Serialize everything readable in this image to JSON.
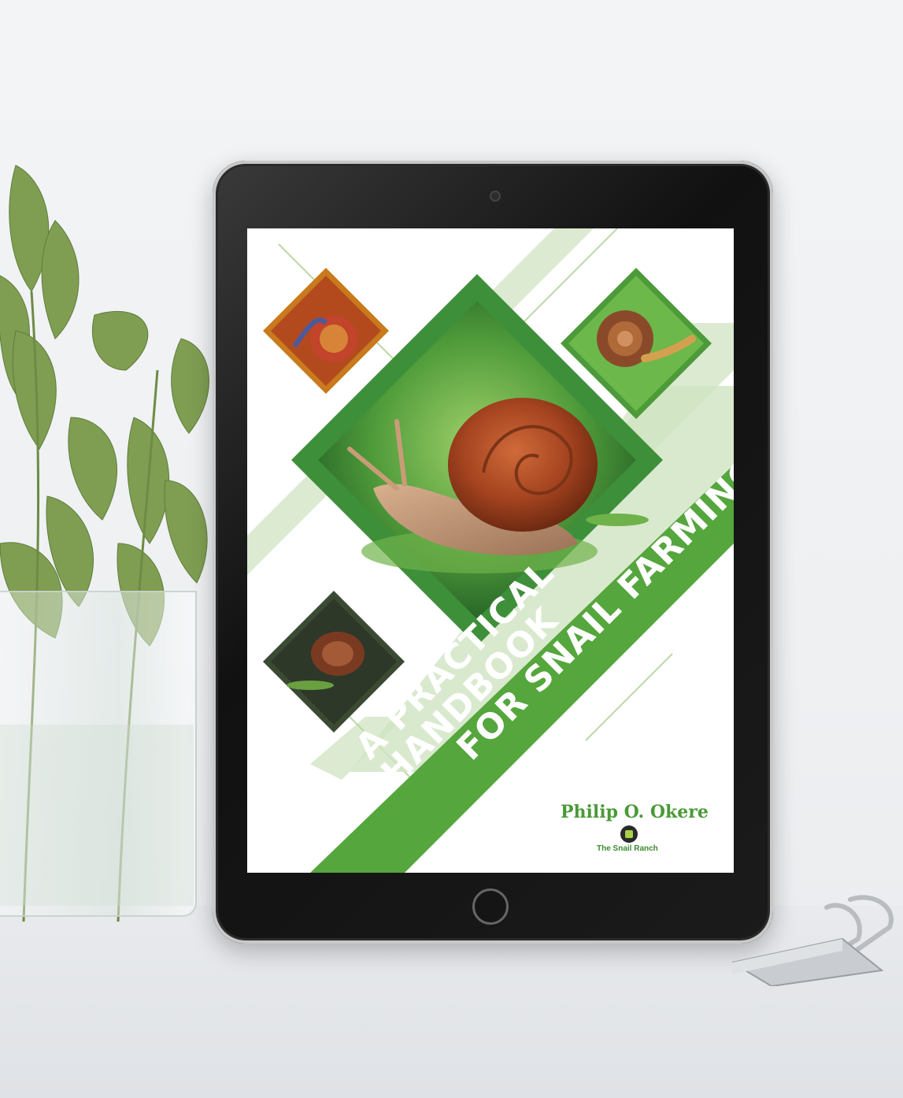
{
  "cover": {
    "title_line1": "A PRACTICAL HANDBOOK",
    "title_line2": "FOR SNAIL FARMING",
    "author": "Philip O. Okere",
    "publisher": "The Snail Ranch"
  },
  "colors": {
    "brand_green": "#4a9a38",
    "light_green": "#cfe3c2",
    "dark_green": "#2f7a33"
  }
}
